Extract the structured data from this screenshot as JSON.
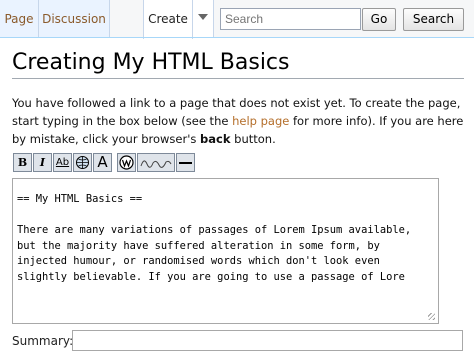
{
  "tabs": {
    "page": "Page",
    "discussion": "Discussion",
    "create": "Create"
  },
  "search": {
    "placeholder": "Search",
    "go_label": "Go",
    "search_label": "Search"
  },
  "page_title": "Creating My HTML Basics",
  "intro": {
    "before_link": "You have followed a link to a page that does not exist yet. To create the page, start typing in the box below (see the ",
    "link_text": "help page",
    "after_link": " for more info). If you are here by mistake, click your browser's ",
    "bold_text": "back",
    "end_text": " button."
  },
  "toolbar": {
    "bold": "B",
    "italic": "I",
    "link": "Ab",
    "big_a": "A",
    "sig": "~",
    "icons": [
      "bold-icon",
      "italic-icon",
      "internal-link-icon",
      "external-link-icon",
      "headline-icon",
      "wikilink-icon",
      "signature-icon",
      "horizontal-line-icon"
    ]
  },
  "editor_text": "== My HTML Basics ==\n\nThere are many variations of passages of Lorem Ipsum available, but the majority have suffered alteration in some form, by injected humour, or randomised words which don't look even slightly believable. If you are going to use a passage of Lore",
  "summary_label": "Summary:"
}
